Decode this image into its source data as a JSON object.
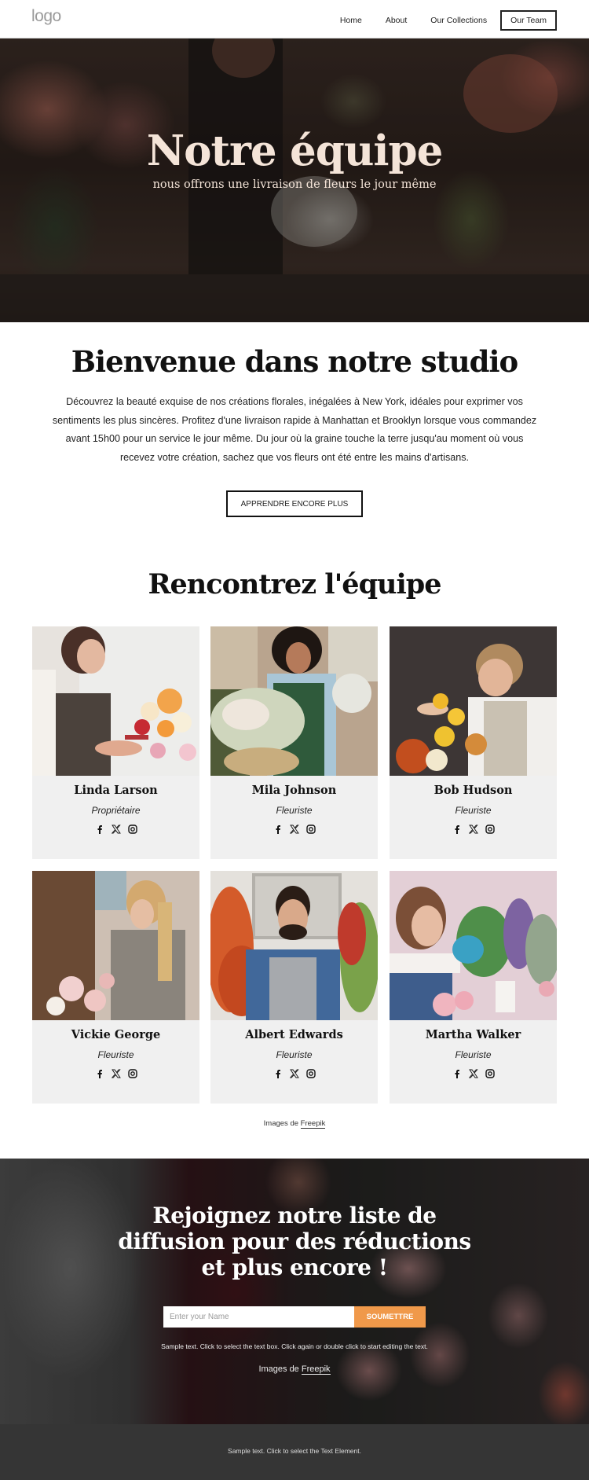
{
  "header": {
    "logo": "logo",
    "nav": [
      {
        "label": "Home",
        "active": false
      },
      {
        "label": "About",
        "active": false
      },
      {
        "label": "Our Collections",
        "active": false
      },
      {
        "label": "Our Team",
        "active": true
      }
    ]
  },
  "hero": {
    "title": "Notre équipe",
    "subtitle": "nous offrons une livraison de fleurs le jour même"
  },
  "welcome": {
    "title": "Bienvenue dans notre studio",
    "text": "Découvrez la beauté exquise de nos créations florales, inégalées à New York, idéales pour exprimer vos sentiments les plus sincères. Profitez d'une livraison rapide à Manhattan et Brooklyn lorsque vous commandez avant 15h00 pour un service le jour même. Du jour où la graine touche la terre jusqu'au moment où vous recevez votre création, sachez que vos fleurs ont été entre les mains d'artisans.",
    "button": "APPRENDRE ENCORE PLUS"
  },
  "team": {
    "title": "Rencontrez l'équipe",
    "members": [
      {
        "name": "Linda Larson",
        "role": "Propriétaire",
        "photo": "woman-cutting-flowers-icon"
      },
      {
        "name": "Mila Johnson",
        "role": "Fleuriste",
        "photo": "woman-holding-basket-icon"
      },
      {
        "name": "Bob Hudson",
        "role": "Fleuriste",
        "photo": "man-arranging-flowers-icon"
      },
      {
        "name": "Vickie George",
        "role": "Fleuriste",
        "photo": "woman-arranging-roses-icon"
      },
      {
        "name": "Albert Edwards",
        "role": "Fleuriste",
        "photo": "man-in-apron-icon"
      },
      {
        "name": "Martha Walker",
        "role": "Fleuriste",
        "photo": "woman-with-pink-flowers-icon"
      }
    ],
    "socials": [
      "facebook-icon",
      "x-icon",
      "instagram-icon"
    ],
    "credit_prefix": "Images de ",
    "credit_link": "Freepik"
  },
  "newsletter": {
    "title": "Rejoignez notre liste de diffusion pour des réductions et plus encore !",
    "input_placeholder": "Enter your Name",
    "input_value": "",
    "button": "SOUMETTRE",
    "sample_text": "Sample text. Click to select the text box. Click again or double click to start editing the text.",
    "credit_prefix": "Images de ",
    "credit_link": "Freepik"
  },
  "footer": {
    "text": "Sample text. Click to select the Text Element."
  },
  "colors": {
    "accent": "#f0994a",
    "hero_text": "#f4e4d8",
    "card_bg": "#f0f0f0",
    "footer_bg": "#353535"
  }
}
